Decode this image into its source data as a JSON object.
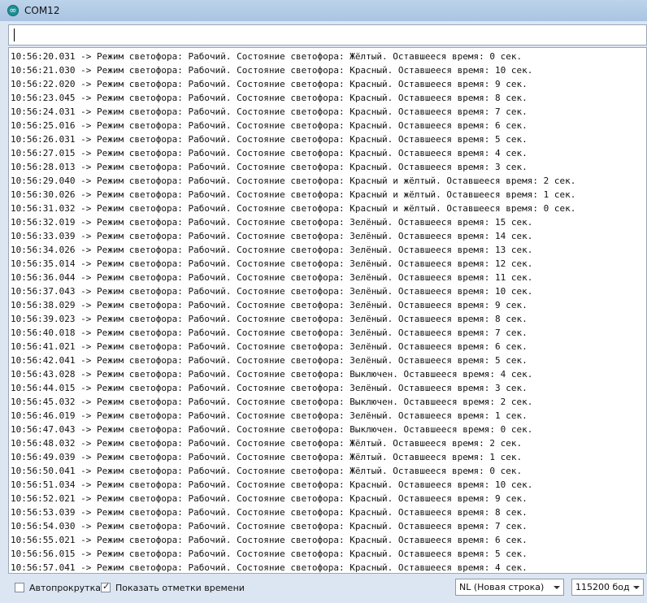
{
  "window": {
    "title": "COM12"
  },
  "send": {
    "value": ""
  },
  "log_lines": [
    "10:56:20.031 -> Режим светофора: Рабочий. Состояние светофора: Жёлтый. Оставшееся время: 0 сек.",
    "10:56:21.030 -> Режим светофора: Рабочий. Состояние светофора: Красный. Оставшееся время: 10 сек.",
    "10:56:22.020 -> Режим светофора: Рабочий. Состояние светофора: Красный. Оставшееся время: 9 сек.",
    "10:56:23.045 -> Режим светофора: Рабочий. Состояние светофора: Красный. Оставшееся время: 8 сек.",
    "10:56:24.031 -> Режим светофора: Рабочий. Состояние светофора: Красный. Оставшееся время: 7 сек.",
    "10:56:25.016 -> Режим светофора: Рабочий. Состояние светофора: Красный. Оставшееся время: 6 сек.",
    "10:56:26.031 -> Режим светофора: Рабочий. Состояние светофора: Красный. Оставшееся время: 5 сек.",
    "10:56:27.015 -> Режим светофора: Рабочий. Состояние светофора: Красный. Оставшееся время: 4 сек.",
    "10:56:28.013 -> Режим светофора: Рабочий. Состояние светофора: Красный. Оставшееся время: 3 сек.",
    "10:56:29.040 -> Режим светофора: Рабочий. Состояние светофора: Красный и жёлтый. Оставшееся время: 2 сек.",
    "10:56:30.026 -> Режим светофора: Рабочий. Состояние светофора: Красный и жёлтый. Оставшееся время: 1 сек.",
    "10:56:31.032 -> Режим светофора: Рабочий. Состояние светофора: Красный и жёлтый. Оставшееся время: 0 сек.",
    "10:56:32.019 -> Режим светофора: Рабочий. Состояние светофора: Зелёный. Оставшееся время: 15 сек.",
    "10:56:33.039 -> Режим светофора: Рабочий. Состояние светофора: Зелёный. Оставшееся время: 14 сек.",
    "10:56:34.026 -> Режим светофора: Рабочий. Состояние светофора: Зелёный. Оставшееся время: 13 сек.",
    "10:56:35.014 -> Режим светофора: Рабочий. Состояние светофора: Зелёный. Оставшееся время: 12 сек.",
    "10:56:36.044 -> Режим светофора: Рабочий. Состояние светофора: Зелёный. Оставшееся время: 11 сек.",
    "10:56:37.043 -> Режим светофора: Рабочий. Состояние светофора: Зелёный. Оставшееся время: 10 сек.",
    "10:56:38.029 -> Режим светофора: Рабочий. Состояние светофора: Зелёный. Оставшееся время: 9 сек.",
    "10:56:39.023 -> Режим светофора: Рабочий. Состояние светофора: Зелёный. Оставшееся время: 8 сек.",
    "10:56:40.018 -> Режим светофора: Рабочий. Состояние светофора: Зелёный. Оставшееся время: 7 сек.",
    "10:56:41.021 -> Режим светофора: Рабочий. Состояние светофора: Зелёный. Оставшееся время: 6 сек.",
    "10:56:42.041 -> Режим светофора: Рабочий. Состояние светофора: Зелёный. Оставшееся время: 5 сек.",
    "10:56:43.028 -> Режим светофора: Рабочий. Состояние светофора: Выключен. Оставшееся время: 4 сек.",
    "10:56:44.015 -> Режим светофора: Рабочий. Состояние светофора: Зелёный. Оставшееся время: 3 сек.",
    "10:56:45.032 -> Режим светофора: Рабочий. Состояние светофора: Выключен. Оставшееся время: 2 сек.",
    "10:56:46.019 -> Режим светофора: Рабочий. Состояние светофора: Зелёный. Оставшееся время: 1 сек.",
    "10:56:47.043 -> Режим светофора: Рабочий. Состояние светофора: Выключен. Оставшееся время: 0 сек.",
    "10:56:48.032 -> Режим светофора: Рабочий. Состояние светофора: Жёлтый. Оставшееся время: 2 сек.",
    "10:56:49.039 -> Режим светофора: Рабочий. Состояние светофора: Жёлтый. Оставшееся время: 1 сек.",
    "10:56:50.041 -> Режим светофора: Рабочий. Состояние светофора: Жёлтый. Оставшееся время: 0 сек.",
    "10:56:51.034 -> Режим светофора: Рабочий. Состояние светофора: Красный. Оставшееся время: 10 сек.",
    "10:56:52.021 -> Режим светофора: Рабочий. Состояние светофора: Красный. Оставшееся время: 9 сек.",
    "10:56:53.039 -> Режим светофора: Рабочий. Состояние светофора: Красный. Оставшееся время: 8 сек.",
    "10:56:54.030 -> Режим светофора: Рабочий. Состояние светофора: Красный. Оставшееся время: 7 сек.",
    "10:56:55.021 -> Режим светофора: Рабочий. Состояние светофора: Красный. Оставшееся время: 6 сек.",
    "10:56:56.015 -> Режим светофора: Рабочий. Состояние светофора: Красный. Оставшееся время: 5 сек.",
    "10:56:57.041 -> Режим светофора: Рабочий. Состояние светофора: Красный. Оставшееся время: 4 сек."
  ],
  "status": {
    "autoscroll": {
      "label": "Автопрокрутка",
      "checked": false
    },
    "timestamps": {
      "label": "Показать отметки времени",
      "checked": true
    },
    "line_ending": "NL (Новая строка)",
    "baud": "115200 бод"
  }
}
